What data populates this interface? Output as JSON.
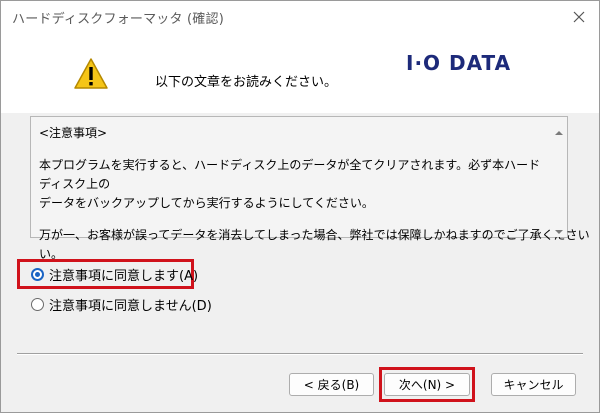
{
  "window": {
    "title": "ハードディスクフォーマッタ (確認)"
  },
  "header": {
    "instruction": "以下の文章をお読みください。",
    "logo_text": "I·O DATA",
    "warning_icon": "warning-icon"
  },
  "notice": {
    "heading": "<注意事項>",
    "line1": "本プログラムを実行すると、ハードディスク上のデータが全てクリアされます。必ず本ハードディスク上の",
    "line2": "データをバックアップしてから実行するようにしてください。",
    "line3": "万が一、お客様が誤ってデータを消去してしまった場合、弊社では保障しかねますのでご了承ください",
    "line4": "い。"
  },
  "options": {
    "agree_label": "注意事項に同意します(A)",
    "disagree_label": "注意事項に同意しません(D)",
    "selected": "agree"
  },
  "buttons": {
    "back_label": "< 戻る(B)",
    "next_label": "次へ(N) >",
    "cancel_label": "キャンセル"
  },
  "colors": {
    "highlight": "#d0121b",
    "logo": "#1d2a7a",
    "radio_selected": "#1a64c4"
  }
}
